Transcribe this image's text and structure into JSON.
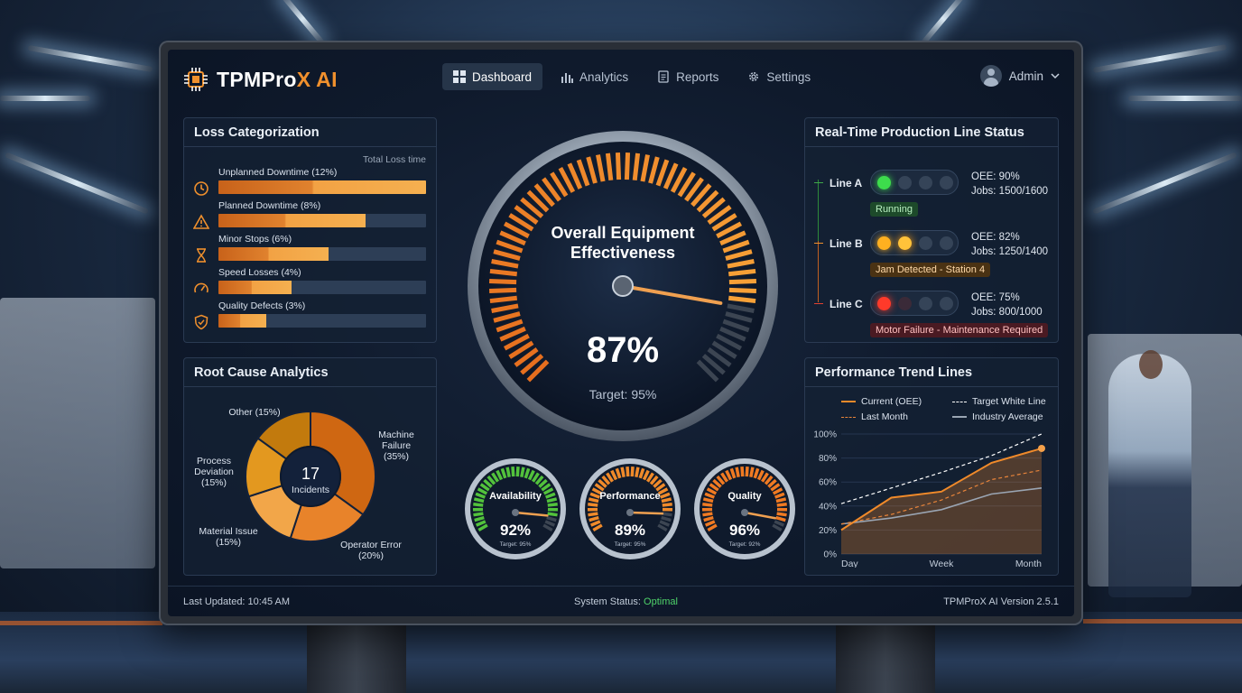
{
  "brand": {
    "name_white": "TPMPro",
    "name_orange": "X AI"
  },
  "nav": [
    {
      "label": "Dashboard",
      "active": true,
      "icon": "grid-icon"
    },
    {
      "label": "Analytics",
      "active": false,
      "icon": "bar-chart-icon"
    },
    {
      "label": "Reports",
      "active": false,
      "icon": "document-icon"
    },
    {
      "label": "Settings",
      "active": false,
      "icon": "gear-icon"
    }
  ],
  "user": {
    "name": "Admin"
  },
  "loss": {
    "title": "Loss Categorization",
    "subtitle": "Total Loss time",
    "items": [
      {
        "label": "Unplanned Downtime (12%)",
        "icon": "clock-icon",
        "fill": 1.0
      },
      {
        "label": "Planned Downtime (8%)",
        "icon": "warning-icon",
        "fill": 0.71
      },
      {
        "label": "Minor Stops (6%)",
        "icon": "hourglass-icon",
        "fill": 0.53
      },
      {
        "label": "Speed Losses (4%)",
        "icon": "speed-icon",
        "fill": 0.35
      },
      {
        "label": "Quality Defects (3%)",
        "icon": "shield-check-icon",
        "fill": 0.23
      }
    ]
  },
  "root_cause": {
    "title": "Root Cause Analytics",
    "center_value": "17",
    "center_label": "Incidents",
    "slices": [
      {
        "label": "Machine Failure",
        "pct": "(35%)",
        "value": 35,
        "color": "#cf6712"
      },
      {
        "label": "Operator Error",
        "pct": "(20%)",
        "value": 20,
        "color": "#e8832a"
      },
      {
        "label": "Material Issue",
        "pct": "(15%)",
        "value": 15,
        "color": "#f2a649"
      },
      {
        "label": "Process Deviation",
        "pct": "(15%)",
        "value": 15,
        "color": "#e3981f"
      },
      {
        "label": "Other",
        "pct": "(15%)",
        "value": 15,
        "color": "#c27a0d"
      }
    ]
  },
  "oee": {
    "title_line1": "Overall Equipment",
    "title_line2": "Effectiveness",
    "value": "87%",
    "fraction": 0.87,
    "target": "Target: 95%"
  },
  "kpis": [
    {
      "name": "Availability",
      "value": "92%",
      "target": "Target: 95%",
      "fraction": 0.92,
      "color": "#52c23c"
    },
    {
      "name": "Performance",
      "value": "89%",
      "target": "Target: 95%",
      "fraction": 0.89,
      "color": "#f08a2a"
    },
    {
      "name": "Quality",
      "value": "96%",
      "target": "Target: 92%",
      "fraction": 0.96,
      "color": "#f07a22"
    }
  ],
  "production": {
    "title": "Real-Time Production Line Status",
    "lines": [
      {
        "name": "Line A",
        "oee": "OEE: 90%",
        "jobs": "Jobs: 1500/1600",
        "status": "Running",
        "light": "green"
      },
      {
        "name": "Line B",
        "oee": "OEE: 82%",
        "jobs": "Jobs: 1250/1400",
        "status": "Jam Detected - Station 4",
        "light": "yellow"
      },
      {
        "name": "Line C",
        "oee": "OEE: 75%",
        "jobs": "Jobs: 800/1000",
        "status": "Motor Failure - Maintenance Required",
        "light": "red"
      }
    ]
  },
  "trend": {
    "title": "Performance Trend Lines",
    "legend": [
      {
        "label": "Current (OEE)",
        "style": "solid",
        "color": "#f08a2a"
      },
      {
        "label": "Target  White Line",
        "style": "dashed",
        "color": "#ffffff"
      },
      {
        "label": "Last Month",
        "style": "dashed",
        "color": "#e8843a"
      },
      {
        "label": "Industry Average",
        "style": "solid",
        "color": "#9aa5b3"
      }
    ],
    "y_ticks": [
      "100%",
      "80%",
      "60%",
      "40%",
      "20%",
      "0%"
    ],
    "x_ticks": [
      "Day",
      "Week",
      "Month"
    ]
  },
  "chart_data": {
    "type": "line",
    "title": "Performance Trend Lines",
    "x": [
      0,
      0.25,
      0.5,
      0.75,
      1
    ],
    "ylim": [
      0,
      100
    ],
    "series": [
      {
        "name": "Current (OEE)",
        "values": [
          20,
          47,
          52,
          76,
          88
        ]
      },
      {
        "name": "Target  White Line",
        "values": [
          42,
          55,
          68,
          82,
          100
        ]
      },
      {
        "name": "Last Month",
        "values": [
          25,
          33,
          45,
          62,
          70
        ]
      },
      {
        "name": "Industry Average",
        "values": [
          25,
          30,
          37,
          50,
          55
        ]
      }
    ]
  },
  "footer": {
    "updated": "Last Updated: 10:45 AM",
    "status_label": "System Status: ",
    "status_value": "Optimal",
    "version": "TPMProX AI Version 2.5.1"
  }
}
